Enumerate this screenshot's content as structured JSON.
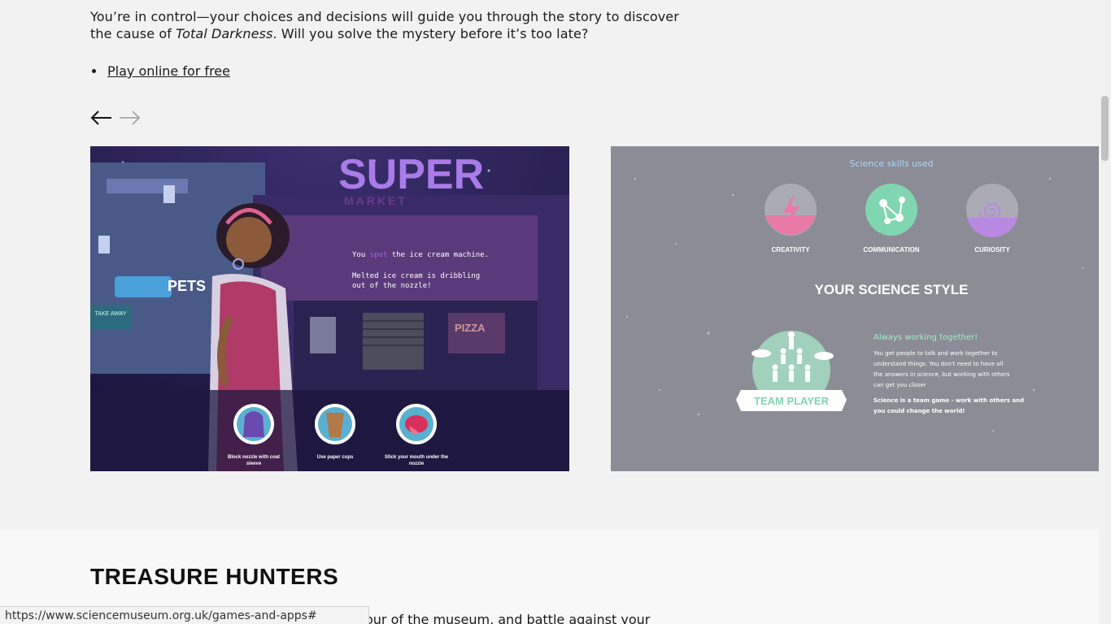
{
  "intro": {
    "text_before": "You’re in control—your choices and decisions will guide you through the story to discover the cause of ",
    "title_italic": "Total Darkness",
    "text_after": ". Will you solve the mystery before it’s too late?"
  },
  "links": [
    {
      "label": "Play online for free"
    }
  ],
  "carousel": {
    "prev_icon": "arrow-left-icon",
    "next_icon": "arrow-right-icon"
  },
  "slide1": {
    "store_sign": "SUPER",
    "store_sign_sub": "MARKET",
    "pets_sign": "PETS",
    "pizza_sign": "PIZZA",
    "take_away": "TAKE AWAY",
    "narration_pre": "You ",
    "narration_highlight": "spot",
    "narration_post": " the ice cream machine.",
    "narration_line2": "Melted ice cream is dribbling",
    "narration_line3": "out of the nozzle!",
    "choices": [
      {
        "label_l1": "Block nozzle with coat",
        "label_l2": "sleeve",
        "icon": "coat-icon"
      },
      {
        "label_l1": "Use paper cups",
        "label_l2": "",
        "icon": "paper-cup-icon"
      },
      {
        "label_l1": "Stick your mouth under the",
        "label_l2": "nozzle",
        "icon": "mouth-icon"
      }
    ],
    "colors": {
      "bg": "#2a2250",
      "highlight": "#b05cf0"
    }
  },
  "slide2": {
    "header": "Science skills used",
    "skills": [
      {
        "label": "CREATIVITY",
        "icon": "lightning-icon",
        "color": "#e87aa8"
      },
      {
        "label": "COMMUNICATION",
        "icon": "network-icon",
        "color": "#7fd6b0"
      },
      {
        "label": "CURIOSITY",
        "icon": "spiral-icon",
        "color": "#b889e0"
      }
    ],
    "style_title": "YOUR SCIENCE STYLE",
    "badge_label": "TEAM PLAYER",
    "result_title": "Always working together!",
    "result_body_1": "You get people to talk and work together to",
    "result_body_2": "understand things. You don't need to have all",
    "result_body_3": "the answers in science, but working with others",
    "result_body_4": "can get you closer",
    "result_tagline_1": "Science is a team game - work with others and",
    "result_tagline_2": "you could change the world!",
    "colors": {
      "accent": "#9ef0c4",
      "header": "#a9d8f5"
    }
  },
  "next_section": {
    "title": "TREASURE HUNTERS",
    "partial_text": "our of the museum, and battle against your"
  },
  "status_bar": {
    "url": "https://www.sciencemuseum.org.uk/games-and-apps#"
  }
}
